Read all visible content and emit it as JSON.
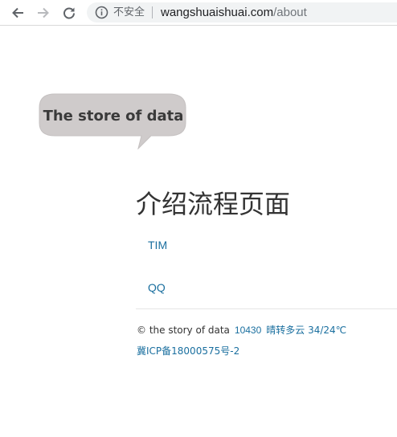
{
  "browser": {
    "security_label": "不安全",
    "url_host": "wangshuaishuai.com",
    "url_path": "/about"
  },
  "logo": {
    "text": "The store of data"
  },
  "page": {
    "heading": "介绍流程页面",
    "links": [
      {
        "label": "TIM"
      },
      {
        "label": "QQ"
      }
    ]
  },
  "footer": {
    "copyright": "© the story of data",
    "visit_count": "10430",
    "weather": "晴转多云 34/24℃",
    "icp": "冀ICP备18000575号-2"
  },
  "colors": {
    "link": "#1a6f9f",
    "logo_bubble": "#cfcbcb"
  }
}
